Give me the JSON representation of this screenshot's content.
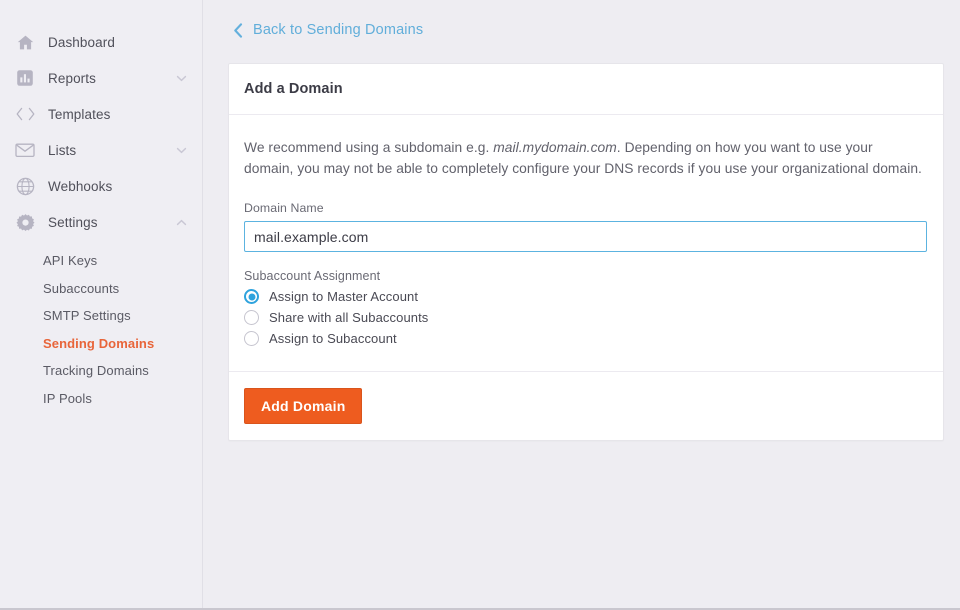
{
  "colors": {
    "page_background": "#eeedf2",
    "sidebar_background": "#efeef3",
    "accent_orange": "#e8653a",
    "button_orange": "#ee5c1f",
    "link_blue": "#61aeda",
    "input_focus_blue": "#5cb3e0",
    "radio_blue": "#2fa3dd",
    "card_white": "#ffffff"
  },
  "sidebar": {
    "items": [
      {
        "label": "Dashboard",
        "icon": "home-icon",
        "chevron": "",
        "active": false
      },
      {
        "label": "Reports",
        "icon": "bar-chart-icon",
        "chevron": "chevron-down-icon",
        "active": false
      },
      {
        "label": "Templates",
        "icon": "code-brackets-icon",
        "chevron": "",
        "active": false
      },
      {
        "label": "Lists",
        "icon": "envelope-icon",
        "chevron": "chevron-down-icon",
        "active": false
      },
      {
        "label": "Webhooks",
        "icon": "globe-icon",
        "chevron": "",
        "active": false
      },
      {
        "label": "Settings",
        "icon": "gear-icon",
        "chevron": "chevron-up-icon",
        "active": false
      }
    ],
    "settings_subitems": [
      {
        "label": "API Keys",
        "active": false
      },
      {
        "label": "Subaccounts",
        "active": false
      },
      {
        "label": "SMTP Settings",
        "active": false
      },
      {
        "label": "Sending Domains",
        "active": true
      },
      {
        "label": "Tracking Domains",
        "active": false
      },
      {
        "label": "IP Pools",
        "active": false
      }
    ]
  },
  "main": {
    "back_link": {
      "label": "Back to Sending Domains",
      "icon": "chevron-left-icon"
    },
    "card": {
      "title": "Add a Domain",
      "description_part1": "We recommend using a subdomain e.g. ",
      "description_emphasis": "mail.mydomain.com",
      "description_part2": ". Depending on how you want to use your domain, you may not be able to completely configure your DNS records if you use your organizational domain.",
      "domain_field": {
        "label": "Domain Name",
        "value": "mail.example.com",
        "placeholder": "",
        "focused": true
      },
      "subaccount_group": {
        "label": "Subaccount Assignment",
        "options": [
          {
            "label": "Assign to Master Account",
            "checked": true
          },
          {
            "label": "Share with all Subaccounts",
            "checked": false
          },
          {
            "label": "Assign to Subaccount",
            "checked": false
          }
        ]
      },
      "submit_button": {
        "label": "Add Domain"
      }
    }
  }
}
